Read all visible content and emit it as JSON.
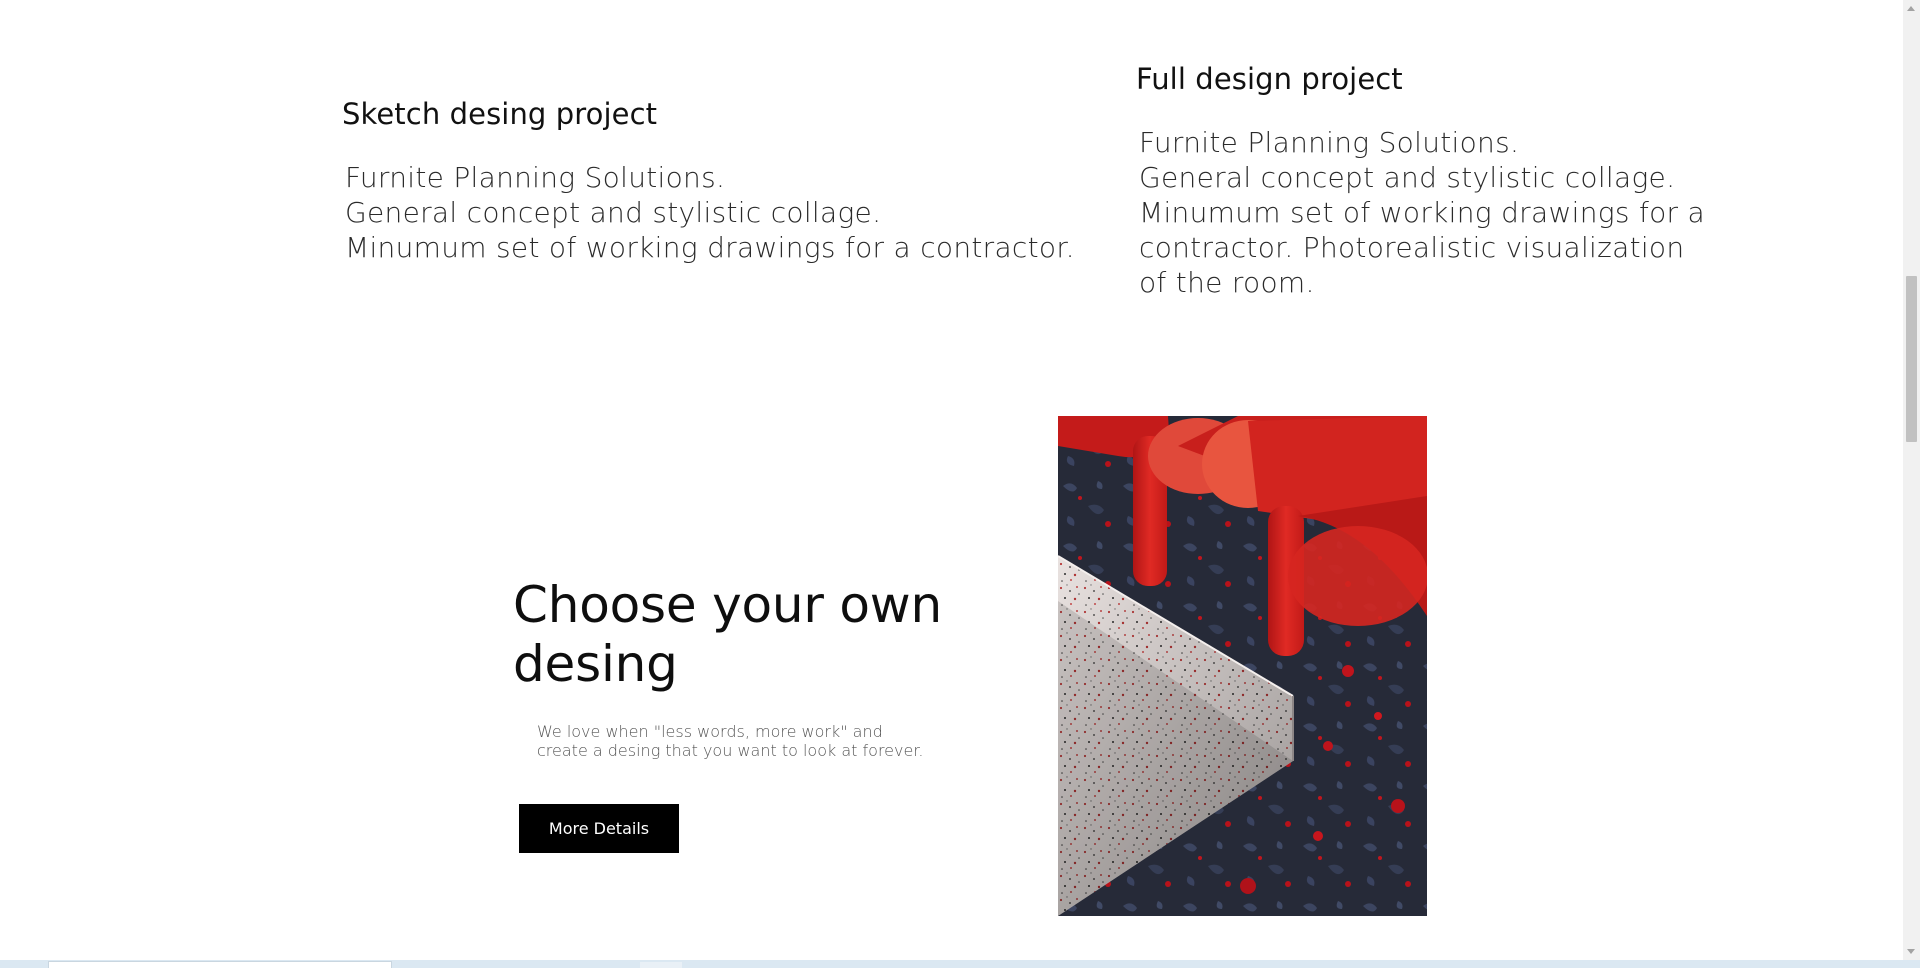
{
  "plans": [
    {
      "title": "Sketch desing project",
      "lines": [
        "Furnite Planning Solutions.",
        "General concept and stylistic collage.",
        "Minumum set of working drawings for a contractor."
      ]
    },
    {
      "title": "Full design project",
      "lines": [
        "Furnite Planning Solutions.",
        "General concept and stylistic collage.",
        "Minumum set of working drawings for a",
        "contractor. Photorealistic visualization",
        "of the room."
      ]
    }
  ],
  "feature": {
    "heading_line1": "Choose your own",
    "heading_line2": "desing",
    "desc_line1": "We love when \"less words, more work\" and",
    "desc_line2": "create a desing that you want to look at forever.",
    "button_label": "More Details"
  },
  "colors": {
    "button_bg": "#000000",
    "chair_red": "#d8231f",
    "floor_dark": "#262a38"
  }
}
